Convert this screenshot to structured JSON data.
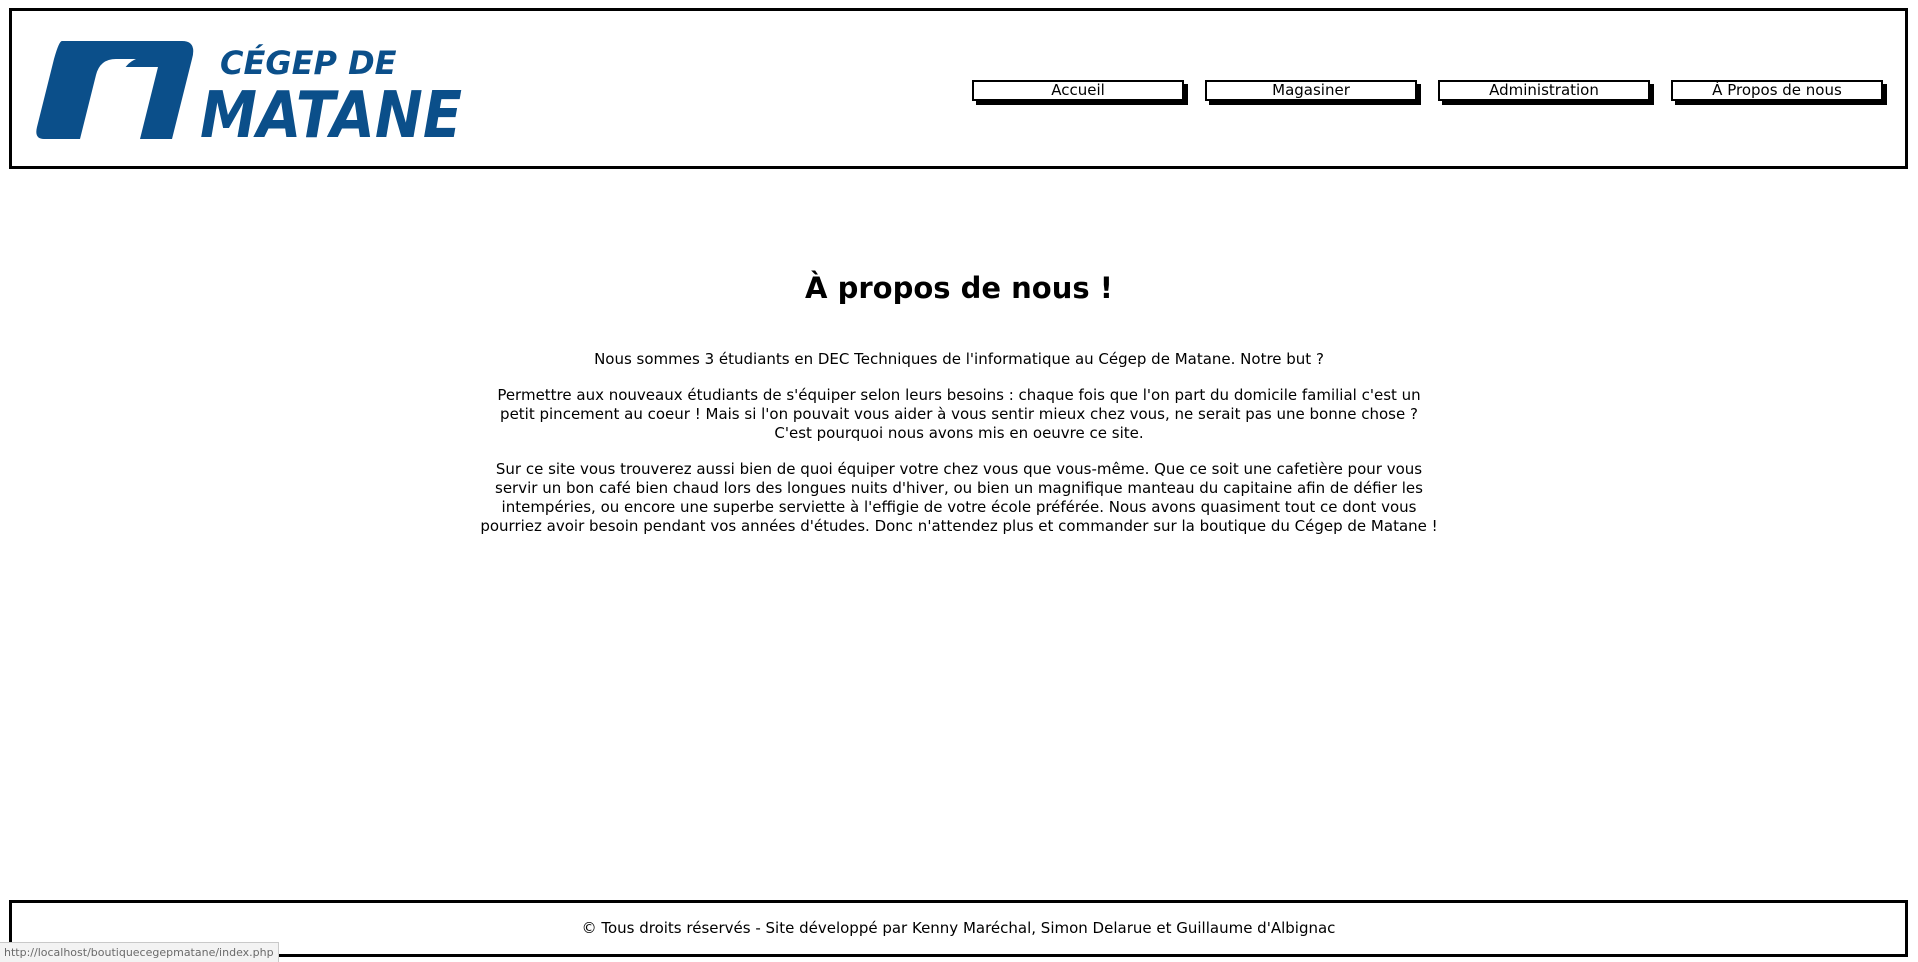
{
  "header": {
    "logo": {
      "line1": "CÉGEP DE",
      "line2": "MATANE",
      "color": "#0b4f8a"
    },
    "nav": [
      {
        "label": "Accueil"
      },
      {
        "label": "Magasiner"
      },
      {
        "label": "Administration"
      },
      {
        "label": "À Propos de nous"
      }
    ]
  },
  "main": {
    "title": "À propos de nous !",
    "paragraphs": [
      "Nous sommes 3 étudiants en DEC Techniques de l'informatique au Cégep de Matane. Notre but ?",
      "Permettre aux nouveaux étudiants de s'équiper selon leurs besoins : chaque fois que l'on part du domicile familial c'est un petit pincement au coeur ! Mais si l'on pouvait vous aider à vous sentir mieux chez vous, ne serait pas une bonne chose ? C'est pourquoi nous avons mis en oeuvre ce site.",
      "Sur ce site vous trouverez aussi bien de quoi équiper votre chez vous que vous-même. Que ce soit une cafetière pour vous servir un bon café bien chaud lors des longues nuits d'hiver, ou bien un magnifique manteau du capitaine afin de défier les intempéries, ou encore une superbe serviette à l'effigie de votre école préférée. Nous avons quasiment tout ce dont vous pourriez avoir besoin pendant vos années d'études. Donc n'attendez plus et commander sur la boutique du Cégep de Matane !"
    ]
  },
  "footer": {
    "text": "© Tous droits réservés - Site développé par Kenny Maréchal, Simon Delarue et Guillaume d'Albignac"
  },
  "status_bar": {
    "url": "http://localhost/boutiquecegepmatane/index.php"
  }
}
